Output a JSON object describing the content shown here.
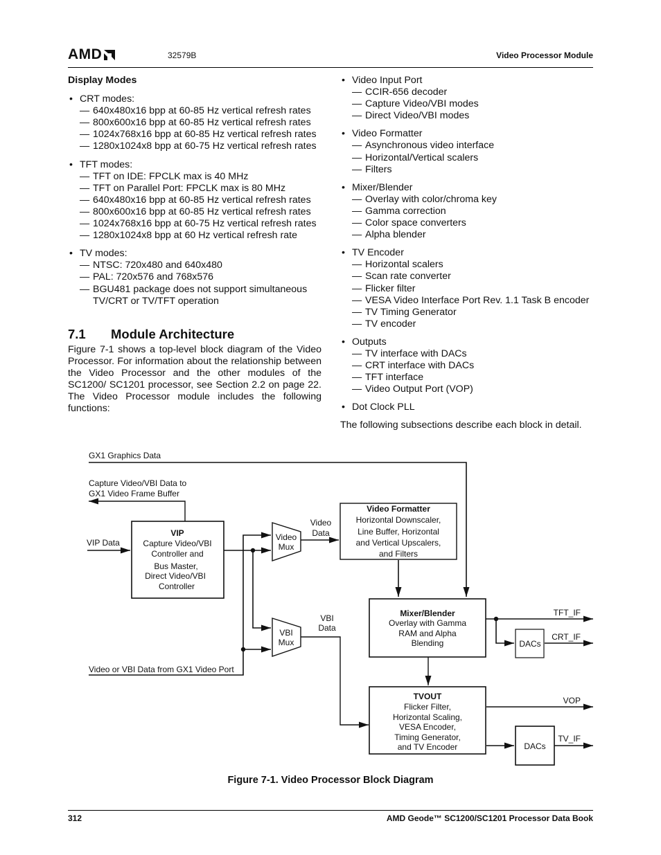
{
  "header": {
    "logo_text": "AMD",
    "doc_number": "32579B",
    "section_title": "Video Processor Module"
  },
  "left_column": {
    "subheading": "Display Modes",
    "groups": [
      {
        "label": "CRT modes:",
        "items": [
          "640x480x16 bpp at 60-85 Hz vertical refresh rates",
          "800x600x16 bpp at 60-85 Hz vertical refresh rates",
          "1024x768x16 bpp at 60-85 Hz vertical refresh rates",
          "1280x1024x8 bpp at 60-75 Hz vertical refresh rates"
        ]
      },
      {
        "label": "TFT modes:",
        "items": [
          "TFT on IDE: FPCLK max is 40 MHz",
          "TFT on Parallel Port: FPCLK max is 80 MHz",
          "640x480x16 bpp at 60-85 Hz vertical refresh rates",
          "800x600x16 bpp at 60-85 Hz vertical refresh rates",
          "1024x768x16 bpp at 60-75 Hz vertical refresh rates",
          "1280x1024x8 bpp at 60 Hz vertical refresh rate"
        ]
      },
      {
        "label": "TV modes:",
        "items": [
          "NTSC: 720x480 and 640x480",
          "PAL: 720x576 and 768x576",
          "BGU481 package does not support simultaneous"
        ],
        "continuation": "TV/CRT or TV/TFT operation"
      }
    ],
    "section": {
      "number": "7.1",
      "title": "Module Architecture",
      "paragraph": "Figure 7-1 shows a top-level block diagram of the Video Processor. For information about the relationship between the Video Processor and the other modules of the SC1200/ SC1201 processor, see Section 2.2 on page 22. The Video Processor module includes the following functions:"
    }
  },
  "right_column": {
    "groups": [
      {
        "label": "Video Input Port",
        "items": [
          "CCIR-656 decoder",
          "Capture Video/VBI modes",
          "Direct Video/VBI modes"
        ]
      },
      {
        "label": "Video Formatter",
        "items": [
          "Asynchronous video interface",
          "Horizontal/Vertical scalers",
          "Filters"
        ]
      },
      {
        "label": "Mixer/Blender",
        "items": [
          "Overlay with color/chroma key",
          "Gamma correction",
          "Color space converters",
          "Alpha blender"
        ]
      },
      {
        "label": "TV Encoder",
        "items": [
          "Horizontal scalers",
          "Scan rate converter",
          "Flicker filter",
          "VESA Video Interface Port Rev. 1.1 Task B encoder",
          "TV Timing Generator",
          "TV encoder"
        ]
      },
      {
        "label": "Outputs",
        "items": [
          "TV interface with DACs",
          "CRT interface with DACs",
          "TFT interface",
          "Video Output Port (VOP)"
        ]
      },
      {
        "label": "Dot Clock PLL",
        "items": []
      }
    ],
    "closing": "The following subsections describe each block in detail."
  },
  "diagram": {
    "labels": {
      "gx1_graphics": "GX1 Graphics Data",
      "capture_line1": "Capture Video/VBI Data to",
      "capture_line2": "GX1 Video Frame Buffer",
      "vip_data": "VIP Data",
      "gx1_video_port": "Video or VBI Data from GX1 Video Port",
      "video_data_1": "Video",
      "video_data_2": "Data",
      "vbi_data_1": "VBI",
      "vbi_data_2": "Data",
      "tft_if": "TFT_IF",
      "crt_if": "CRT_IF",
      "vop": "VOP",
      "tv_if": "TV_IF"
    },
    "vip": {
      "title": "VIP",
      "lines": [
        "Capture Video/VBI",
        "Controller and",
        "Bus Master,",
        "Direct Video/VBI",
        "Controller"
      ]
    },
    "video_mux": {
      "lines": [
        "Video",
        "Mux"
      ]
    },
    "vbi_mux": {
      "lines": [
        "VBI",
        "Mux"
      ]
    },
    "video_formatter": {
      "title": "Video Formatter",
      "lines": [
        "Horizontal Downscaler,",
        "Line Buffer, Horizontal",
        "and Vertical Upscalers,",
        "and Filters"
      ]
    },
    "mixer": {
      "title": "Mixer/Blender",
      "lines": [
        "Overlay with Gamma",
        "RAM and Alpha",
        "Blending"
      ]
    },
    "tvout": {
      "title": "TVOUT",
      "lines": [
        "Flicker Filter,",
        "Horizontal Scaling,",
        "VESA Encoder,",
        "Timing Generator,",
        "and TV Encoder"
      ]
    },
    "dacs_crt": "DACs",
    "dacs_tv": "DACs"
  },
  "caption": "Figure 7-1.  Video Processor Block Diagram",
  "footer": {
    "page_number": "312",
    "book_title": "AMD Geode™ SC1200/SC1201 Processor Data Book"
  }
}
